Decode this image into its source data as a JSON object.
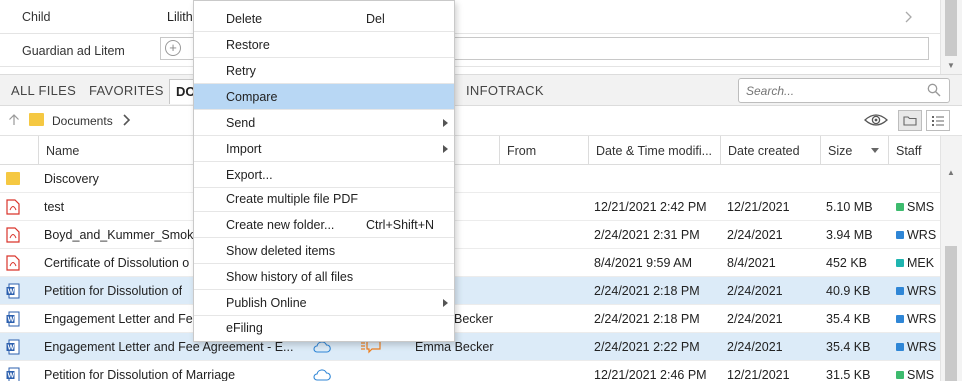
{
  "form": {
    "child_label": "Child",
    "child_value": "Lilith",
    "guardian_label": "Guardian ad Litem",
    "add_symbol": "+"
  },
  "tabs": {
    "all_files": "ALL FILES",
    "favorites": "FAVORITES",
    "documents": "DOCUMENTS",
    "infotrack": "INFOTRACK"
  },
  "search": {
    "placeholder": "Search..."
  },
  "breadcrumb": {
    "folder": "Documents"
  },
  "columns": {
    "name": "Name",
    "from": "From",
    "modified": "Date & Time modifi...",
    "created": "Date created",
    "size": "Size",
    "staff": "Staff"
  },
  "rows": [
    {
      "type": "folder",
      "name": "Discovery",
      "from": "",
      "modified": "",
      "created": "",
      "size": "",
      "staff": "",
      "staff_color": ""
    },
    {
      "type": "pdf",
      "name": "test",
      "from": "",
      "modified": "12/21/2021 2:42 PM",
      "created": "12/21/2021",
      "size": "5.10 MB",
      "staff": "SMS",
      "staff_color": "#3dbb6e"
    },
    {
      "type": "pdf",
      "name": "Boyd_and_Kummer_Smok",
      "from": "",
      "modified": "2/24/2021 2:31 PM",
      "created": "2/24/2021",
      "size": "3.94 MB",
      "staff": "WRS",
      "staff_color": "#2f86d6"
    },
    {
      "type": "pdf",
      "name": "Certificate of Dissolution o",
      "from": "",
      "modified": "8/4/2021 9:59 AM",
      "created": "8/4/2021",
      "size": "452 KB",
      "staff": "MEK",
      "staff_color": "#1fb5b0"
    },
    {
      "type": "word",
      "name": "Petition for Dissolution of",
      "from": "",
      "modified": "2/24/2021 2:18 PM",
      "created": "2/24/2021",
      "size": "40.9 KB",
      "staff": "WRS",
      "staff_color": "#2f86d6"
    },
    {
      "type": "word",
      "name": "Engagement Letter and Fe",
      "from": "Becker",
      "modified": "2/24/2021 2:18 PM",
      "created": "2/24/2021",
      "size": "35.4 KB",
      "staff": "WRS",
      "staff_color": "#2f86d6"
    },
    {
      "type": "word",
      "name": "Engagement Letter and Fee Agreement - E...",
      "from": "Emma Becker",
      "modified": "2/24/2021 2:22 PM",
      "created": "2/24/2021",
      "size": "35.4 KB",
      "staff": "WRS",
      "staff_color": "#2f86d6"
    },
    {
      "type": "word",
      "name": "Petition for Dissolution of Marriage",
      "from": "",
      "modified": "12/21/2021 2:46 PM",
      "created": "12/21/2021",
      "size": "31.5 KB",
      "staff": "SMS",
      "staff_color": "#3dbb6e"
    }
  ],
  "menu": [
    {
      "label": "Delete",
      "shortcut": "Del"
    },
    {
      "label": "Restore",
      "shortcut": ""
    },
    {
      "label": "Retry",
      "shortcut": ""
    },
    {
      "label": "Compare",
      "shortcut": ""
    },
    {
      "label": "Send",
      "shortcut": ""
    },
    {
      "label": "Import",
      "shortcut": ""
    },
    {
      "label": "Export...",
      "shortcut": ""
    },
    {
      "label": "Create multiple file PDF",
      "shortcut": ""
    },
    {
      "label": "Create new folder...",
      "shortcut": "Ctrl+Shift+N"
    },
    {
      "label": "Show deleted items",
      "shortcut": ""
    },
    {
      "label": "Show history of all files",
      "shortcut": ""
    },
    {
      "label": "Publish Online",
      "shortcut": ""
    },
    {
      "label": "eFiling",
      "shortcut": ""
    }
  ],
  "colors": {
    "selected_row": "#dcebf8",
    "menu_highlight": "#b8d7f4",
    "folder": "#f5c842",
    "pdf": "#d9342b",
    "word": "#2b5fae",
    "comment": "#f07f1e",
    "cloud": "#2f86d6"
  }
}
